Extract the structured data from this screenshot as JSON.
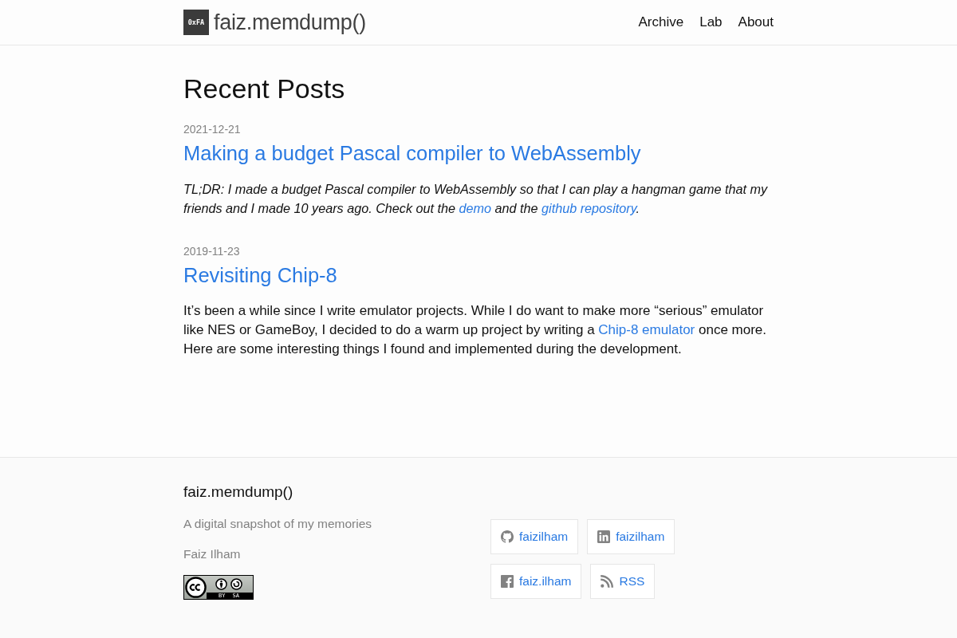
{
  "header": {
    "logo_text": "0xFA",
    "site_title": "faiz.memdump()",
    "nav": [
      "Archive",
      "Lab",
      "About"
    ]
  },
  "main": {
    "heading": "Recent Posts",
    "posts": [
      {
        "date": "2021-12-21",
        "title": "Making a budget Pascal compiler to WebAssembly",
        "italic": true,
        "excerpt": [
          {
            "kind": "text",
            "text": "TL;DR: I made a budget Pascal compiler to WebAssembly so that I can play a hangman game that my friends and I made 10 years ago. Check out the "
          },
          {
            "kind": "link",
            "text": "demo"
          },
          {
            "kind": "text",
            "text": " and the "
          },
          {
            "kind": "link",
            "text": "github repository"
          },
          {
            "kind": "text",
            "text": "."
          }
        ]
      },
      {
        "date": "2019-11-23",
        "title": "Revisiting Chip-8",
        "italic": false,
        "excerpt": [
          {
            "kind": "text",
            "text": "It’s been a while since I write emulator projects. While I do want to make more “serious” emulator like NES or GameBoy, I decided to do a warm up project by writing a "
          },
          {
            "kind": "link",
            "text": "Chip-8 emulator"
          },
          {
            "kind": "text",
            "text": " once more. Here are some interesting things I found and implemented during the development."
          }
        ]
      }
    ]
  },
  "footer": {
    "title": "faiz.memdump()",
    "description": "A digital snapshot of my memories",
    "author": "Faiz Ilham",
    "license_badge": {
      "labels": [
        "BY",
        "SA"
      ]
    },
    "social_links": [
      {
        "kind": "github",
        "label": "faizilham"
      },
      {
        "kind": "linkedin",
        "label": "faizilham"
      },
      {
        "kind": "facebook",
        "label": "faiz.ilham"
      },
      {
        "kind": "rss",
        "label": "RSS"
      }
    ]
  }
}
